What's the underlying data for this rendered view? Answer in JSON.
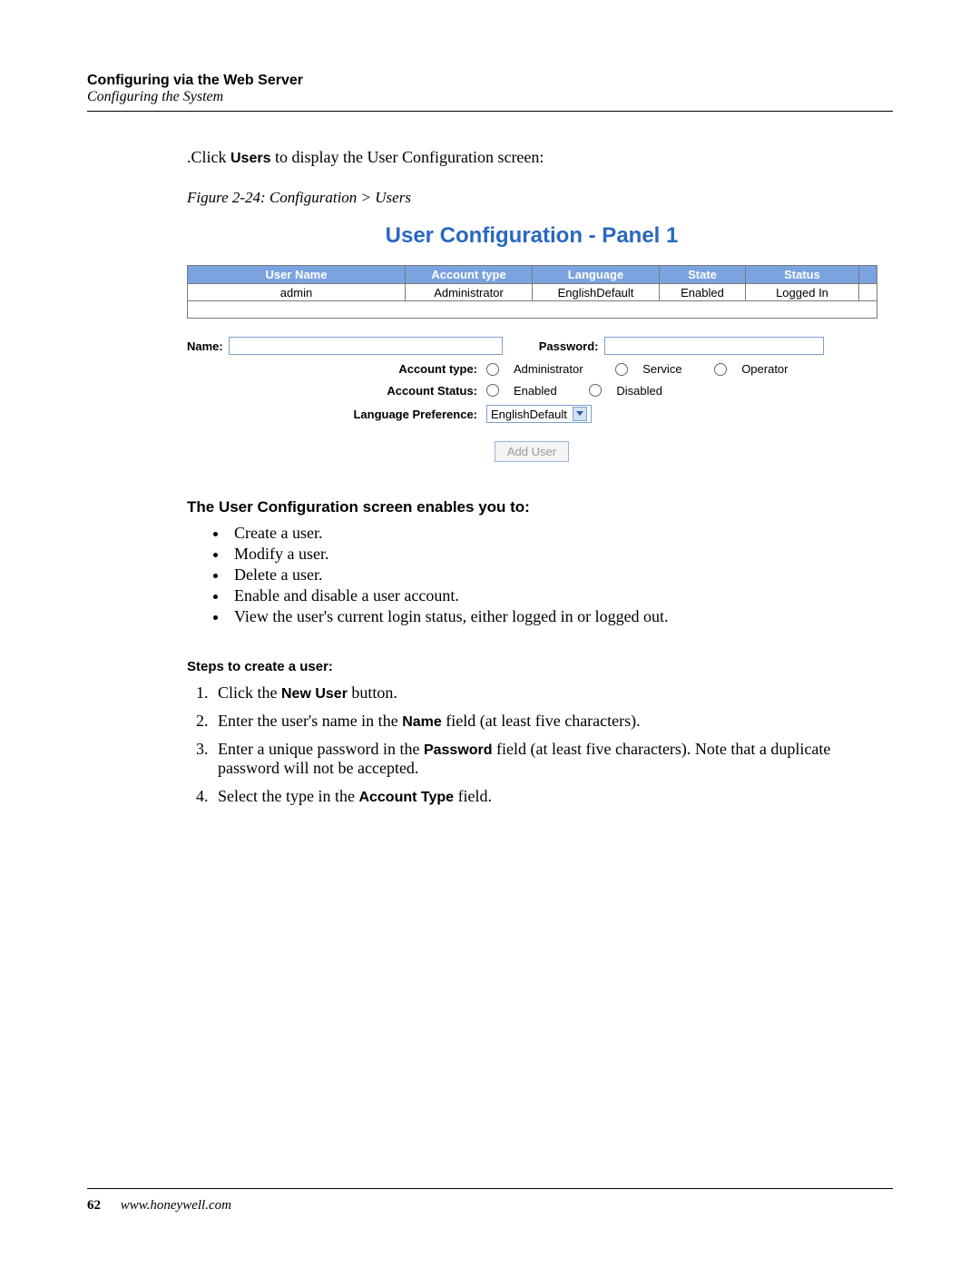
{
  "header": {
    "title_bold": "Configuring via the Web Server",
    "title_italic": "Configuring the System"
  },
  "intro": {
    "prefix": ".Click ",
    "link_word": "Users",
    "suffix": " to display the User Configuration screen:"
  },
  "figure_caption": "Figure 2-24:   Configuration > Users",
  "screenshot": {
    "title": "User Configuration - Panel 1",
    "table": {
      "headers": [
        "User Name",
        "Account type",
        "Language",
        "State",
        "Status"
      ],
      "rows": [
        [
          "admin",
          "Administrator",
          "EnglishDefault",
          "Enabled",
          "Logged In"
        ]
      ]
    },
    "form": {
      "name_label": "Name:",
      "password_label": "Password:",
      "account_type_label": "Account type:",
      "account_type_options": [
        "Administrator",
        "Service",
        "Operator"
      ],
      "account_status_label": "Account Status:",
      "account_status_options": [
        "Enabled",
        "Disabled"
      ],
      "language_pref_label": "Language Preference:",
      "language_pref_value": "EnglishDefault",
      "button": "Add User"
    }
  },
  "enables_heading": "The User Configuration screen enables you to:",
  "enables_list": [
    "Create a user.",
    "Modify a user.",
    "Delete a user.",
    "Enable and disable a user account.",
    "View the user's current login status, either logged in or logged out."
  ],
  "steps_heading": "Steps to create a user:",
  "steps": {
    "s1": {
      "pre": "Click the ",
      "bold": "New User",
      "post": " button."
    },
    "s2": {
      "pre": "Enter the user's name in the ",
      "bold": "Name",
      "post": " field (at least five characters)."
    },
    "s3": {
      "pre": "Enter a unique password in the ",
      "bold": "Password",
      "post": " field (at least five characters). Note that a duplicate password will not be accepted."
    },
    "s4": {
      "pre": "Select the type in the ",
      "bold": "Account Type",
      "post": " field."
    }
  },
  "footer": {
    "page_number": "62",
    "url": "www.honeywell.com"
  }
}
